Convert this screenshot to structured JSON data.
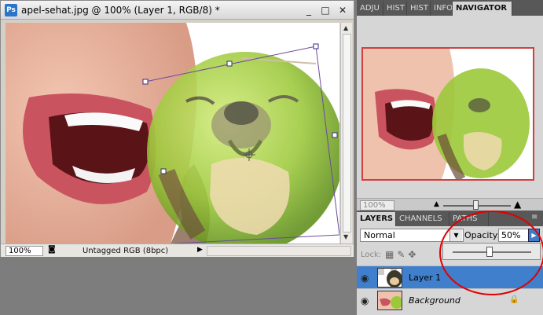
{
  "document": {
    "app_icon": "Ps",
    "title": "apel-sehat.jpg @ 100% (Layer 1, RGB/8) *",
    "window_buttons": [
      "_",
      "□",
      "✕"
    ],
    "zoom": "100%",
    "status": "Untagged RGB (8bpc)"
  },
  "panels": {
    "top_tabs": [
      "ADJU",
      "HIST",
      "HIST",
      "INFO",
      "NAVIGATOR"
    ],
    "active_top_tab": "NAVIGATOR",
    "navigator_zoom": "100%",
    "layers_tabs": [
      "LAYERS",
      "CHANNELS",
      "PATHS"
    ],
    "blend_mode": "Normal",
    "opacity_label": "Opacity:",
    "opacity_value": "50%",
    "opacity_level": 0.5,
    "lock_label": "Lock:",
    "layers": [
      {
        "name": "Layer 1",
        "selected": true
      },
      {
        "name": "Background",
        "selected": false,
        "locked": true
      }
    ]
  },
  "colors": {
    "selected_layer": "#3f7fcc",
    "annotation": "#e00000",
    "navigator_frame": "#cf4040"
  }
}
